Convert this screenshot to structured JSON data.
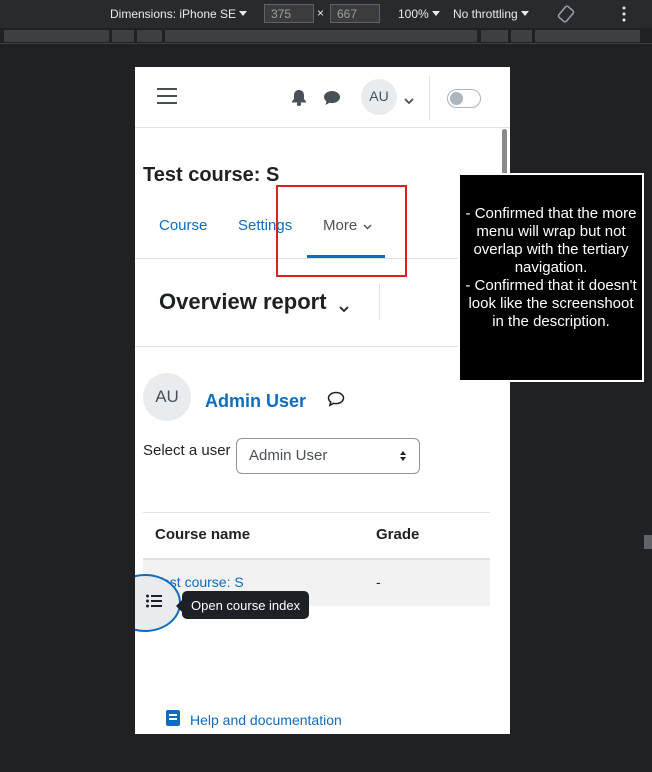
{
  "devtools": {
    "dimensions_label": "Dimensions: iPhone SE",
    "width_value": "375",
    "height_value": "667",
    "times_symbol": "×",
    "zoom": "100%",
    "throttling": "No throttling",
    "rotate_icon": "rotate-icon",
    "more_icon": "vertical-ellipsis-icon"
  },
  "navbar": {
    "avatar_initials": "AU",
    "icons": [
      "hamburger-menu-icon",
      "notification-bell-icon",
      "messages-icon",
      "chevron-down-icon"
    ],
    "dark_mode_toggle": "off"
  },
  "course": {
    "title": "Test course: S",
    "tabs": [
      {
        "label": "Course"
      },
      {
        "label": "Settings"
      },
      {
        "label": "More",
        "active": true
      }
    ]
  },
  "report": {
    "title": "Overview report"
  },
  "user": {
    "avatar_initials": "AU",
    "name": "Admin User",
    "select_label": "Select a user",
    "select_value": "Admin User"
  },
  "table": {
    "headers": [
      "Course name",
      "Grade"
    ],
    "rows": [
      {
        "course": "Test course: S",
        "grade": "-"
      }
    ]
  },
  "drawer": {
    "tooltip": "Open course index"
  },
  "footer": {
    "help_label": "Help and documentation"
  },
  "annotation": {
    "lines": [
      "- Confirmed that the more menu will wrap but not overlap with the tertiary navigation.",
      "- Confirmed that it doesn't look like the screenshoot in the description."
    ]
  },
  "colors": {
    "link": "#0f6cbf",
    "text": "#1d2125",
    "highlight_box": "#e02020"
  }
}
